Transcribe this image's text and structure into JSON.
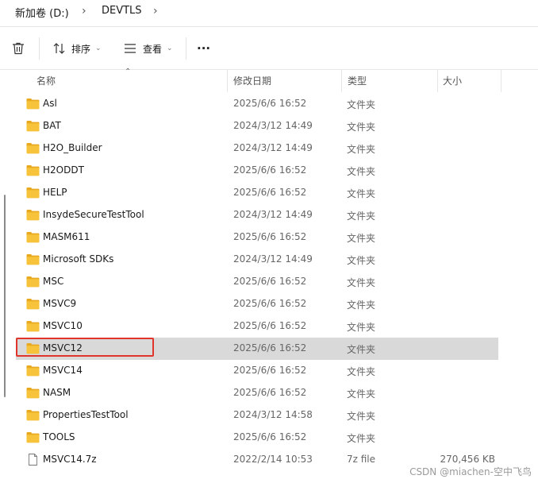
{
  "breadcrumb": {
    "segments": [
      "新加卷 (D:)",
      "DEVTLS"
    ],
    "separator": "›"
  },
  "toolbar": {
    "sort_label": "排序",
    "view_label": "查看",
    "more_label": "···"
  },
  "columns": [
    "名称",
    "修改日期",
    "类型",
    "大小"
  ],
  "files": [
    {
      "name": "Asl",
      "date": "2025/6/6 16:52",
      "type": "文件夹",
      "size": ""
    },
    {
      "name": "BAT",
      "date": "2024/3/12 14:49",
      "type": "文件夹",
      "size": ""
    },
    {
      "name": "H2O_Builder",
      "date": "2024/3/12 14:49",
      "type": "文件夹",
      "size": ""
    },
    {
      "name": "H2ODDT",
      "date": "2025/6/6 16:52",
      "type": "文件夹",
      "size": ""
    },
    {
      "name": "HELP",
      "date": "2025/6/6 16:52",
      "type": "文件夹",
      "size": ""
    },
    {
      "name": "InsydeSecureTestTool",
      "date": "2024/3/12 14:49",
      "type": "文件夹",
      "size": ""
    },
    {
      "name": "MASM611",
      "date": "2025/6/6 16:52",
      "type": "文件夹",
      "size": ""
    },
    {
      "name": "Microsoft SDKs",
      "date": "2024/3/12 14:49",
      "type": "文件夹",
      "size": ""
    },
    {
      "name": "MSC",
      "date": "2025/6/6 16:52",
      "type": "文件夹",
      "size": ""
    },
    {
      "name": "MSVC9",
      "date": "2025/6/6 16:52",
      "type": "文件夹",
      "size": ""
    },
    {
      "name": "MSVC10",
      "date": "2025/6/6 16:52",
      "type": "文件夹",
      "size": ""
    },
    {
      "name": "MSVC12",
      "date": "2025/6/6 16:52",
      "type": "文件夹",
      "size": "",
      "selected": true
    },
    {
      "name": "MSVC14",
      "date": "2025/6/6 16:52",
      "type": "文件夹",
      "size": ""
    },
    {
      "name": "NASM",
      "date": "2025/6/6 16:52",
      "type": "文件夹",
      "size": ""
    },
    {
      "name": "PropertiesTestTool",
      "date": "2024/3/12 14:58",
      "type": "文件夹",
      "size": ""
    },
    {
      "name": "TOOLS",
      "date": "2025/6/6 16:52",
      "type": "文件夹",
      "size": ""
    },
    {
      "name": "MSVC14.7z",
      "date": "2022/2/14 10:53",
      "type": "7z file",
      "size": "270,456 KB",
      "kind": "file"
    }
  ],
  "watermark": "CSDN @miachen-空中飞鸟",
  "colors": {
    "folder": "#f6c33a",
    "folder_tab": "#e9a91e",
    "selected_row": "#d9d9d9",
    "highlight_border": "#e0352b"
  }
}
